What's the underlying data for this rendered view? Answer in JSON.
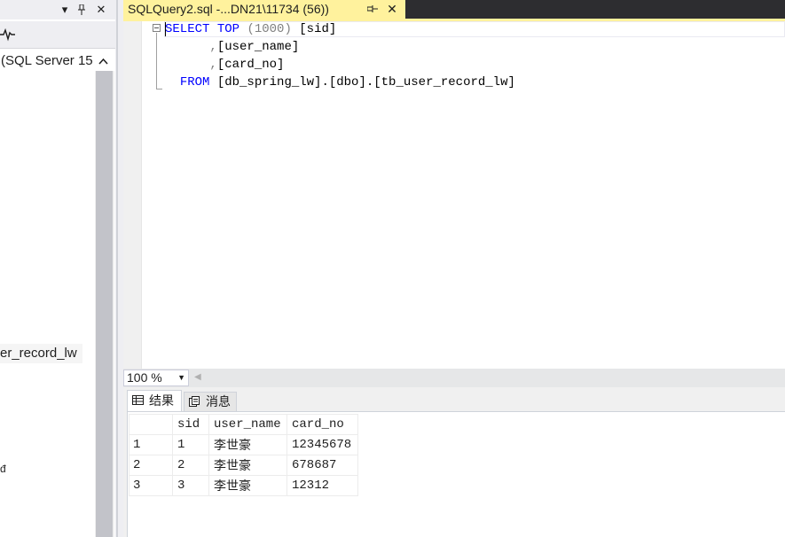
{
  "left_pane": {
    "server_node_label": "(SQL Server 15",
    "table_node_label": "er_record_lw",
    "truncated_node": "đ"
  },
  "document_tab": {
    "title": "SQLQuery2.sql -...DN21\\11734 (56))"
  },
  "editor": {
    "lines": [
      {
        "kw1": "SELECT",
        "kw2": "TOP",
        "punc": "(1000)",
        "rest": "[sid]"
      },
      {
        "comma": ",",
        "rest": "[user_name]"
      },
      {
        "comma": ",",
        "rest": "[card_no]"
      },
      {
        "kw": "FROM",
        "rest": "[db_spring_lw].[dbo].[tb_user_record_lw]"
      }
    ]
  },
  "zoom": {
    "value": "100 %"
  },
  "result_tabs": {
    "results_label": "结果",
    "messages_label": "消息"
  },
  "grid": {
    "columns": [
      "sid",
      "user_name",
      "card_no"
    ],
    "rows": [
      {
        "rownum": "1",
        "sid": "1",
        "user_name": "李世豪",
        "card_no": "12345678"
      },
      {
        "rownum": "2",
        "sid": "2",
        "user_name": "李世豪",
        "card_no": "678687"
      },
      {
        "rownum": "3",
        "sid": "3",
        "user_name": "李世豪",
        "card_no": "12312"
      }
    ]
  },
  "icons": {
    "dropdown": "dropdown-arrow-icon",
    "pin": "pin-icon",
    "close": "close-icon",
    "activity": "activity-monitor-icon",
    "chevron": "chevron-up-icon",
    "grid": "grid-icon",
    "messages": "messages-icon"
  },
  "colors": {
    "tab_active": "#fff29d",
    "tab_strip": "#2d2d30",
    "keyword": "#0000ff",
    "punctuation": "#808080"
  }
}
